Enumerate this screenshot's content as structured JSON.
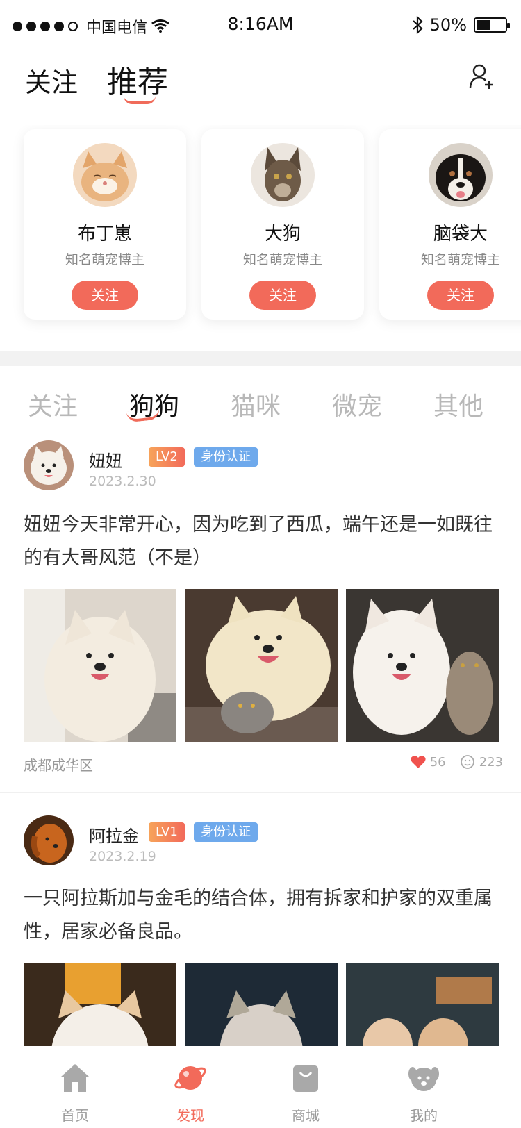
{
  "status_bar": {
    "carrier": "中国电信",
    "time": "8:16AM",
    "battery_percent": "50%",
    "battery_level": 0.5
  },
  "header": {
    "tabs": [
      {
        "label": "关注"
      },
      {
        "label": "推荐"
      }
    ],
    "active_tab": "推荐"
  },
  "bloggers": [
    {
      "name": "布丁崽",
      "desc": "知名萌宠博主",
      "follow_label": "关注"
    },
    {
      "name": "大狗",
      "desc": "知名萌宠博主",
      "follow_label": "关注"
    },
    {
      "name": "脑袋大",
      "desc": "知名萌宠博主",
      "follow_label": "关注"
    }
  ],
  "categories": [
    {
      "label": "关注"
    },
    {
      "label": "狗狗"
    },
    {
      "label": "猫咪"
    },
    {
      "label": "微宠"
    },
    {
      "label": "其他"
    }
  ],
  "active_category": "狗狗",
  "posts": [
    {
      "user": "妞妞",
      "level": "LV2",
      "verified": "身份认证",
      "date": "2023.2.30",
      "text": "妞妞今天非常开心，因为吃到了西瓜，端午还是一如既往的有大哥风范（不是）",
      "location": "成都成华区",
      "likes": "56",
      "comments": "223"
    },
    {
      "user": "阿拉金",
      "level": "LV1",
      "verified": "身份认证",
      "date": "2023.2.19",
      "text": "一只阿拉斯加与金毛的结合体，拥有拆家和护家的双重属性，居家必备良品。"
    }
  ],
  "bottom_nav": [
    {
      "label": "首页",
      "icon": "home-icon"
    },
    {
      "label": "发现",
      "icon": "planet-icon"
    },
    {
      "label": "商城",
      "icon": "shopping-bag-icon"
    },
    {
      "label": "我的",
      "icon": "dog-face-icon"
    }
  ],
  "colors": {
    "accent": "#f26a5a",
    "verified_badge": "#6ea9ec",
    "level_badge": "#f7a45a",
    "inactive_text": "#b8b8b8"
  }
}
